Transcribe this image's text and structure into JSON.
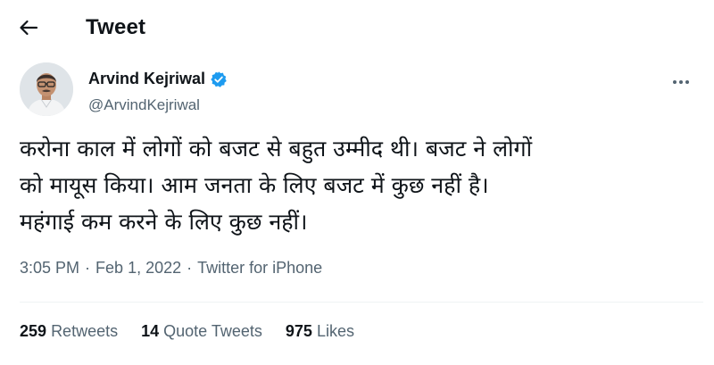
{
  "header": {
    "title": "Tweet",
    "back_icon": "arrow-left-icon"
  },
  "author": {
    "display_name": "Arvind Kejriwal",
    "handle": "@ArvindKejriwal",
    "verified_icon": "verified-badge-icon",
    "more_icon": "more-horizontal-icon"
  },
  "tweet": {
    "text": "करोना काल में लोगों को बजट से बहुत उम्मीद थी। बजट ने लोगों\nको मायूस किया। आम जनता के लिए बजट में कुछ नहीं है।\nमहंगाई कम करने के लिए कुछ नहीं।"
  },
  "meta": {
    "time": "3:05 PM",
    "separator": "·",
    "date": "Feb 1, 2022",
    "source": "Twitter for iPhone"
  },
  "stats": {
    "retweets_count": "259",
    "retweets_label": "Retweets",
    "quotes_count": "14",
    "quotes_label": "Quote Tweets",
    "likes_count": "975",
    "likes_label": "Likes"
  },
  "colors": {
    "text_primary": "#0f1419",
    "text_secondary": "#536471",
    "verified_blue": "#1d9bf0",
    "divider": "#eff3f4"
  }
}
